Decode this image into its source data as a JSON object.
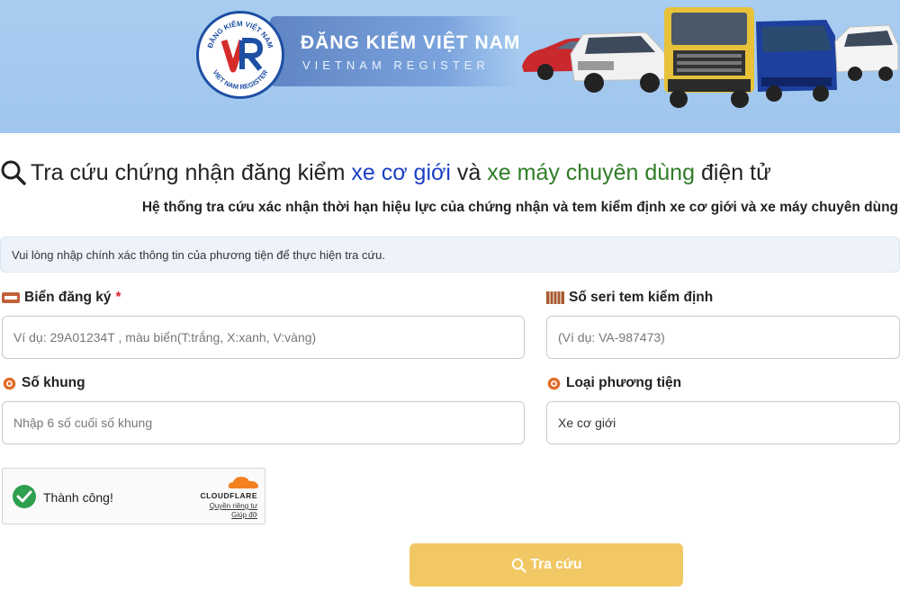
{
  "banner": {
    "logo_text_top": "ĐĂNG KIỂM VIỆT NAM",
    "logo_text_bottom": "VIET NAM REGISTER",
    "logo_mark": "VR",
    "title": "ĐĂNG KIỂM VIỆT NAM",
    "subtitle": "VIETNAM REGISTER"
  },
  "heading": {
    "part1": "Tra cứu chứng nhận đăng kiểm",
    "part2": "xe cơ giới",
    "part3": "và",
    "part4": "xe máy chuyên dùng",
    "part5": "điện tử",
    "icon": "search-icon"
  },
  "subheading": "Hệ thống tra cứu xác nhận thời hạn hiệu lực của chứng nhận và tem kiểm định xe cơ giới và xe máy chuyên dùng",
  "note": "Vui lòng nhập chính xác thông tin của phương tiện để thực hiện tra cứu.",
  "form": {
    "plate": {
      "label": "Biển đăng ký",
      "required_mark": "*",
      "placeholder": "Ví dụ: 29A01234T , màu biển(T:trắng, X:xanh, V:vàng)",
      "icon": "license-plate-icon"
    },
    "serial": {
      "label": "Số seri tem kiểm định",
      "placeholder": "(Ví dụ: VA-987473)",
      "icon": "stamp-icon"
    },
    "chassis": {
      "label": "Số khung",
      "placeholder": "Nhập 6 số cuối số khung",
      "icon": "gear-icon"
    },
    "vehicle_type": {
      "label": "Loại phương tiện",
      "value": "Xe cơ giới",
      "icon": "gear-icon"
    }
  },
  "captcha": {
    "status": "Thành công!",
    "provider": "CLOUDFLARE",
    "privacy_link": "Quyền riêng tư",
    "help_link": "Giúp đỡ"
  },
  "submit": {
    "label": "Tra cứu",
    "icon": "search-icon"
  },
  "colors": {
    "banner_bg": "#a9cdf0",
    "heading_blue": "#1a3fc4",
    "heading_green": "#2f7d26",
    "required": "#d9262b",
    "submit_bg": "#f2c865",
    "success": "#2e9e4f",
    "cloudflare": "#f48120"
  }
}
